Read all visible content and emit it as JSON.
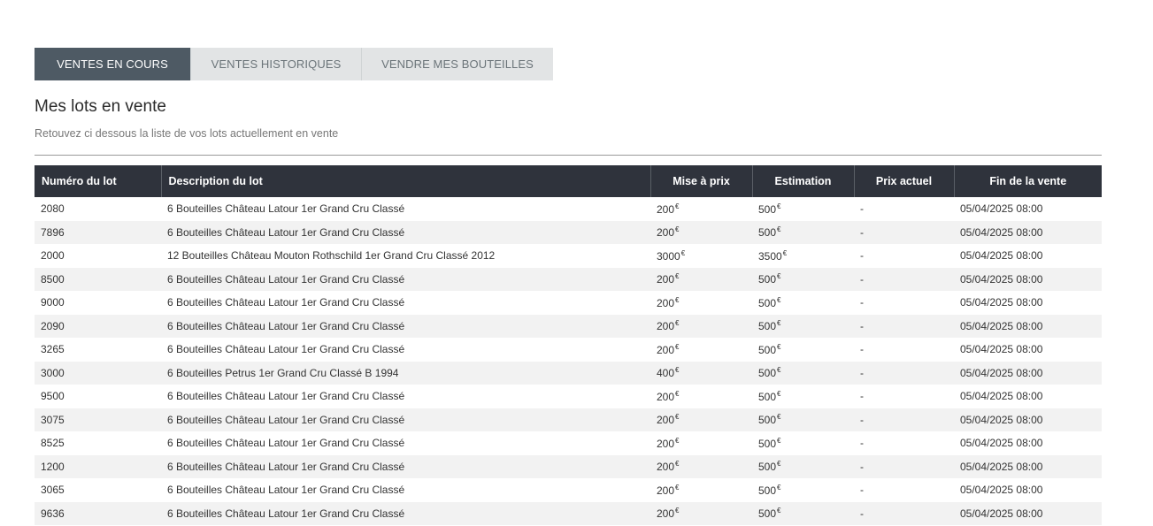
{
  "tabs": [
    {
      "label": "VENTES EN COURS",
      "active": true
    },
    {
      "label": "VENTES HISTORIQUES",
      "active": false
    },
    {
      "label": "VENDRE MES BOUTEILLES",
      "active": false
    }
  ],
  "section": {
    "title": "Mes lots en vente",
    "subtitle": "Retouvez ci dessous la liste de vos lots actuellement en vente"
  },
  "colors": {
    "active_tab": "#4e5a64",
    "inactive_tab": "#e2e4e5",
    "table_header": "#2f333c",
    "row_alt": "#f2f2f2"
  },
  "table": {
    "currency_symbol": "€",
    "headers": [
      "Numéro du lot",
      "Description du lot",
      "Mise à prix",
      "Estimation",
      "Prix actuel",
      "Fin de la vente"
    ],
    "rows": [
      {
        "lot": "2080",
        "description": "6 Bouteilles Château Latour 1er Grand Cru Classé",
        "mise": "200",
        "estimation": "500",
        "prix": "-",
        "fin": "05/04/2025 08:00"
      },
      {
        "lot": "7896",
        "description": "6 Bouteilles Château Latour 1er Grand Cru Classé",
        "mise": "200",
        "estimation": "500",
        "prix": "-",
        "fin": "05/04/2025 08:00"
      },
      {
        "lot": "2000",
        "description": "12 Bouteilles Château Mouton Rothschild 1er Grand Cru Classé 2012",
        "mise": "3000",
        "estimation": "3500",
        "prix": "-",
        "fin": "05/04/2025 08:00"
      },
      {
        "lot": "8500",
        "description": "6 Bouteilles Château Latour 1er Grand Cru Classé",
        "mise": "200",
        "estimation": "500",
        "prix": "-",
        "fin": "05/04/2025 08:00"
      },
      {
        "lot": "9000",
        "description": "6 Bouteilles Château Latour 1er Grand Cru Classé",
        "mise": "200",
        "estimation": "500",
        "prix": "-",
        "fin": "05/04/2025 08:00"
      },
      {
        "lot": "2090",
        "description": "6 Bouteilles Château Latour 1er Grand Cru Classé",
        "mise": "200",
        "estimation": "500",
        "prix": "-",
        "fin": "05/04/2025 08:00"
      },
      {
        "lot": "3265",
        "description": "6 Bouteilles Château Latour 1er Grand Cru Classé",
        "mise": "200",
        "estimation": "500",
        "prix": "-",
        "fin": "05/04/2025 08:00"
      },
      {
        "lot": "3000",
        "description": "6 Bouteilles Petrus 1er Grand Cru Classé B 1994",
        "mise": "400",
        "estimation": "500",
        "prix": "-",
        "fin": "05/04/2025 08:00"
      },
      {
        "lot": "9500",
        "description": "6 Bouteilles Château Latour 1er Grand Cru Classé",
        "mise": "200",
        "estimation": "500",
        "prix": "-",
        "fin": "05/04/2025 08:00"
      },
      {
        "lot": "3075",
        "description": "6 Bouteilles Château Latour 1er Grand Cru Classé",
        "mise": "200",
        "estimation": "500",
        "prix": "-",
        "fin": "05/04/2025 08:00"
      },
      {
        "lot": "8525",
        "description": "6 Bouteilles Château Latour 1er Grand Cru Classé",
        "mise": "200",
        "estimation": "500",
        "prix": "-",
        "fin": "05/04/2025 08:00"
      },
      {
        "lot": "1200",
        "description": "6 Bouteilles Château Latour 1er Grand Cru Classé",
        "mise": "200",
        "estimation": "500",
        "prix": "-",
        "fin": "05/04/2025 08:00"
      },
      {
        "lot": "3065",
        "description": "6 Bouteilles Château Latour 1er Grand Cru Classé",
        "mise": "200",
        "estimation": "500",
        "prix": "-",
        "fin": "05/04/2025 08:00"
      },
      {
        "lot": "9636",
        "description": "6 Bouteilles Château Latour 1er Grand Cru Classé",
        "mise": "200",
        "estimation": "500",
        "prix": "-",
        "fin": "05/04/2025 08:00"
      }
    ]
  }
}
